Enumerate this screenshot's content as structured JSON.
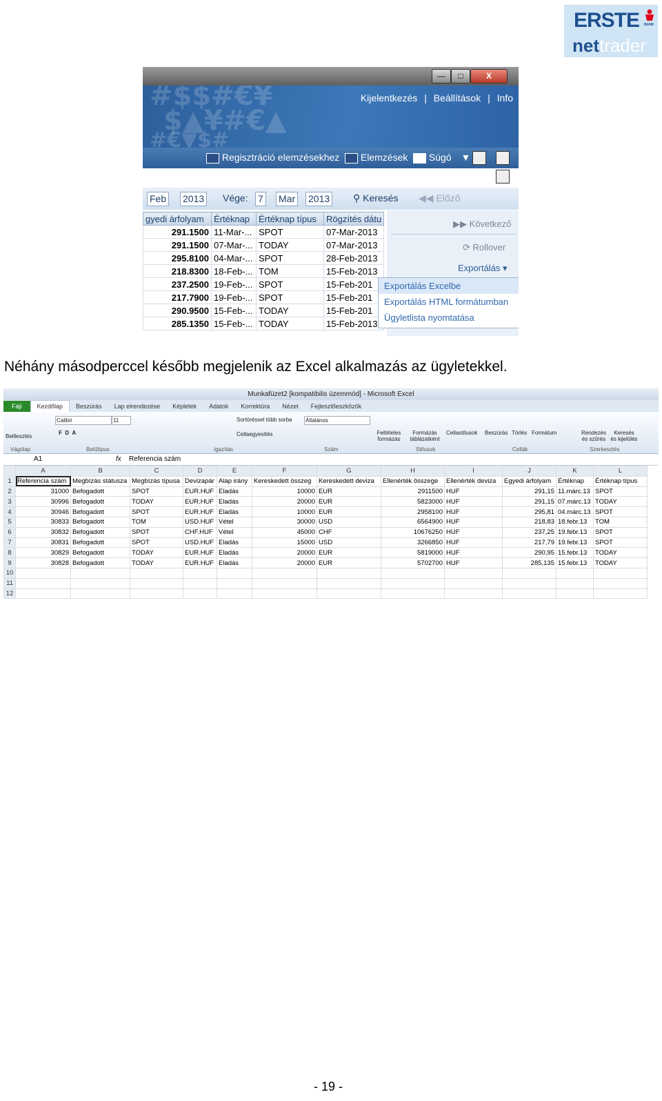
{
  "logo": {
    "line1": "ERSTE",
    "bank": "BANK",
    "line2_a": "net",
    "line2_b": "trader"
  },
  "shot1": {
    "window_buttons": [
      "—",
      "□",
      "X"
    ],
    "topnav": [
      "Kijelentkezés",
      "|",
      "Beállítások",
      "|",
      "Info"
    ],
    "subnav": {
      "reg": "Regisztráció elemzésekhez",
      "elemzesek": "Elemzések",
      "sugo": "Súgó"
    },
    "filter": {
      "from_month": "Feb",
      "from_year": "2013",
      "end_label": "Vége:",
      "to_day": "7",
      "to_month": "Mar",
      "to_year": "2013",
      "search": "Keresés",
      "prev": "Előző"
    },
    "headers": [
      "gyedi árfolyam",
      "Értéknap",
      "Értéknap típus",
      "Rögzítés dátu"
    ],
    "rows": [
      [
        "291.1500",
        "11-Mar-...",
        "SPOT",
        "07-Mar-2013"
      ],
      [
        "291.1500",
        "07-Mar-...",
        "TODAY",
        "07-Mar-2013"
      ],
      [
        "295.8100",
        "04-Mar-...",
        "SPOT",
        "28-Feb-2013"
      ],
      [
        "218.8300",
        "18-Feb-...",
        "TOM",
        "15-Feb-2013"
      ],
      [
        "237.2500",
        "19-Feb-...",
        "SPOT",
        "15-Feb-201"
      ],
      [
        "217.7900",
        "19-Feb-...",
        "SPOT",
        "15-Feb-201"
      ],
      [
        "290.9500",
        "15-Feb-...",
        "TODAY",
        "15-Feb-201"
      ],
      [
        "285.1350",
        "15-Feb-...",
        "TODAY",
        "15-Feb-2013"
      ]
    ],
    "side": {
      "next": "Következő",
      "rollover": "Rollover",
      "export": "Exportálás"
    },
    "menu": [
      "Exportálás Excelbe",
      "Exportálás HTML formátumban",
      "Ügyletlista nyomtatása"
    ]
  },
  "caption": "Néhány másodperccel később megjelenik az Excel alkalmazás az ügyletekkel.",
  "excel": {
    "title": "Munkafüzet2 [kompatibilis üzemmód] - Microsoft Excel",
    "tabs": [
      "Fájl",
      "Kezdőlap",
      "Beszúrás",
      "Lap elrendezése",
      "Képletek",
      "Adatok",
      "Korrektúra",
      "Nézet",
      "Fejlesztőeszközök"
    ],
    "ribbon": {
      "paste": "Beillesztés",
      "font": "Calibri",
      "size": "11",
      "wrap": "Sortöréssel több sorba",
      "merge": "Cellaegyesítés",
      "numfmt": "Általános",
      "cond": "Feltételes formázás",
      "astable": "Formázás táblázatként",
      "styles": "Cellastílusok",
      "insert": "Beszúrás",
      "delete": "Törlés",
      "format": "Formátum",
      "sort": "Rendezés és szűrés",
      "find": "Keresés és kijelölés",
      "groups": [
        "Vágólap",
        "Betűtípus",
        "Igazítás",
        "Szám",
        "Stílusok",
        "Cellák",
        "Szerkesztés"
      ]
    },
    "namebox": "A1",
    "fx": "fx",
    "formula": "Referencia szám",
    "columns": [
      "A",
      "B",
      "C",
      "D",
      "E",
      "F",
      "G",
      "H",
      "I",
      "J",
      "K",
      "L"
    ],
    "rows": [
      [
        "Referencia szám",
        "Megbízás státusza",
        "Megbízás típusa",
        "Devizapár",
        "Alap irány",
        "Kereskedett összeg",
        "Kereskedett deviza",
        "Ellenérték összege",
        "Ellenérték deviza",
        "Egyedi árfolyam",
        "Értéknap",
        "Értéknap típus"
      ],
      [
        "31000",
        "Befogadott",
        "SPOT",
        "EUR.HUF",
        "Eladás",
        "10000",
        "EUR",
        "2911500",
        "HUF",
        "291,15",
        "11.márc.13",
        "SPOT"
      ],
      [
        "30996",
        "Befogadott",
        "TODAY",
        "EUR.HUF",
        "Eladás",
        "20000",
        "EUR",
        "5823000",
        "HUF",
        "291,15",
        "07.márc.13",
        "TODAY"
      ],
      [
        "30946",
        "Befogadott",
        "SPOT",
        "EUR.HUF",
        "Eladás",
        "10000",
        "EUR",
        "2958100",
        "HUF",
        "295,81",
        "04.márc.13",
        "SPOT"
      ],
      [
        "30833",
        "Befogadott",
        "TOM",
        "USD.HUF",
        "Vétel",
        "30000",
        "USD",
        "6564900",
        "HUF",
        "218,83",
        "18.febr.13",
        "TOM"
      ],
      [
        "30832",
        "Befogadott",
        "SPOT",
        "CHF.HUF",
        "Vétel",
        "45000",
        "CHF",
        "10676250",
        "HUF",
        "237,25",
        "19.febr.13",
        "SPOT"
      ],
      [
        "30831",
        "Befogadott",
        "SPOT",
        "USD.HUF",
        "Eladás",
        "15000",
        "USD",
        "3266850",
        "HUF",
        "217,79",
        "19.febr.13",
        "SPOT"
      ],
      [
        "30829",
        "Befogadott",
        "TODAY",
        "EUR.HUF",
        "Eladás",
        "20000",
        "EUR",
        "5819000",
        "HUF",
        "290,95",
        "15.febr.13",
        "TODAY"
      ],
      [
        "30828",
        "Befogadott",
        "TODAY",
        "EUR.HUF",
        "Eladás",
        "20000",
        "EUR",
        "5702700",
        "HUF",
        "285,135",
        "15.febr.13",
        "TODAY"
      ]
    ],
    "empty_rows": [
      "10",
      "11",
      "12"
    ]
  },
  "page_number": "- 19 -"
}
